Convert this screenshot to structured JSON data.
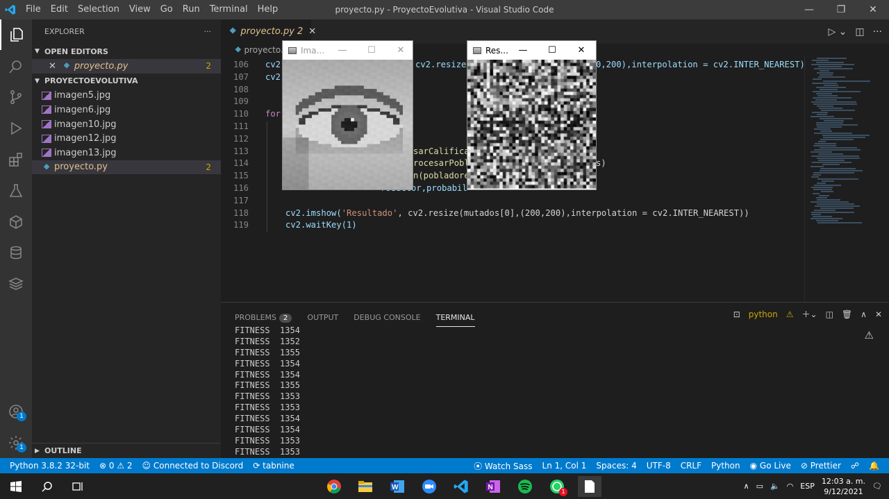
{
  "titlebar": {
    "menu": [
      "File",
      "Edit",
      "Selection",
      "View",
      "Go",
      "Run",
      "Terminal",
      "Help"
    ],
    "title": "proyecto.py - ProyectoEvolutiva - Visual Studio Code",
    "minimize": "—",
    "maximize": "❐",
    "close": "✕"
  },
  "activity_icons": [
    "files-icon",
    "search-icon",
    "source-control-icon",
    "run-debug-icon",
    "extensions-icon",
    "testing-icon",
    "remote-explorer-icon",
    "database-icon",
    "stack-icon",
    "accounts-icon",
    "settings-gear-icon"
  ],
  "activity_badges": {
    "accounts": "1",
    "settings": "1"
  },
  "sidebar": {
    "header": "EXPLORER",
    "more": "···",
    "open_editors_title": "OPEN EDITORS",
    "open_editors": [
      {
        "name": "proyecto.py",
        "problems": "2"
      }
    ],
    "project_title": "PROYECTOEVOLUTIVA",
    "files": [
      {
        "name": "imagen5.jpg",
        "type": "image"
      },
      {
        "name": "imagen6.jpg",
        "type": "image"
      },
      {
        "name": "imagen10.jpg",
        "type": "image"
      },
      {
        "name": "imagen12.jpg",
        "type": "image"
      },
      {
        "name": "imagen13.jpg",
        "type": "image"
      },
      {
        "name": "proyecto.py",
        "type": "python",
        "problems": "2"
      }
    ],
    "outline_title": "OUTLINE"
  },
  "editor": {
    "tab": {
      "name": "proyecto.py",
      "problems": "2"
    },
    "breadcrumb": "proyecto.",
    "lines": [
      {
        "n": "106",
        "html": "<span class='k'>cv2</span>"
      },
      {
        "n": "107",
        "html": "<span class='k'>cv2</span>"
      },
      {
        "n": "108",
        "html": ""
      },
      {
        "n": "109",
        "html": ""
      },
      {
        "n": "110",
        "html": "<span class='kw'>for</span>"
      },
      {
        "n": "111",
        "html": ""
      },
      {
        "n": "112",
        "html": ""
      },
      {
        "n": "113",
        "html": ""
      },
      {
        "n": "114",
        "html": ""
      },
      {
        "n": "115",
        "html": ""
      },
      {
        "n": "116",
        "html": ""
      },
      {
        "n": "117",
        "html": ""
      },
      {
        "n": "118",
        "html": ""
      },
      {
        "n": "119",
        "html": ""
      }
    ],
    "fragments": {
      "l106": "cv2.resize",
      "l106b": "0,200),interpolation = cv2.INTER_NEAREST)",
      "l113": "sarCalifica",
      "l114": "rocesarPobl",
      "l114b": "s)",
      "l115": "n(pobladore",
      "l116": "roductor,probabil",
      "l118_pre": "cv2.imshow(",
      "l118_str": "'Resultado'",
      "l118_mid": ", cv2.resize(mutados[0],(200,200),interpolation = cv2.INTER_NEAREST))",
      "l119": "cv2.waitKey(1)"
    },
    "actions": [
      "run-icon",
      "split-editor-icon",
      "more-icon"
    ]
  },
  "image_window": {
    "title": "Ima...",
    "kind": "eye"
  },
  "result_window": {
    "title": "Res...",
    "kind": "noise"
  },
  "panel": {
    "tabs": [
      "PROBLEMS",
      "OUTPUT",
      "DEBUG CONSOLE",
      "TERMINAL"
    ],
    "problems_count": "2",
    "active_tab": "TERMINAL",
    "terminal_name": "python",
    "terminal_lines": [
      "FITNESS  1354",
      "FITNESS  1352",
      "FITNESS  1355",
      "FITNESS  1354",
      "FITNESS  1354",
      "FITNESS  1355",
      "FITNESS  1353",
      "FITNESS  1353",
      "FITNESS  1354",
      "FITNESS  1354",
      "FITNESS  1353",
      "FITNESS  1353"
    ]
  },
  "statusbar": {
    "left": [
      "Python 3.8.2 32-bit",
      "⊗ 0 ⚠ 2",
      "☺ Connected to Discord",
      "⟳ tabnine"
    ],
    "right": [
      "⦿ Watch Sass",
      "Ln 1, Col 1",
      "Spaces: 4",
      "UTF-8",
      "CRLF",
      "Python",
      "◉ Go Live",
      "⊘ Prettier",
      "☍",
      "🔔"
    ]
  },
  "taskbar": {
    "apps": [
      "chrome-icon",
      "file-explorer-icon",
      "word-icon",
      "zoom-icon",
      "vscode-icon",
      "onenote-icon",
      "spotify-icon",
      "whatsapp-icon",
      "document-icon"
    ],
    "whatsapp_badge": "1",
    "lang": "ESP",
    "time": "12:03 a. m.",
    "date": "9/12/2021"
  },
  "colors": {
    "accent": "#007acc",
    "warning": "#cca700",
    "python": "#519aba"
  }
}
